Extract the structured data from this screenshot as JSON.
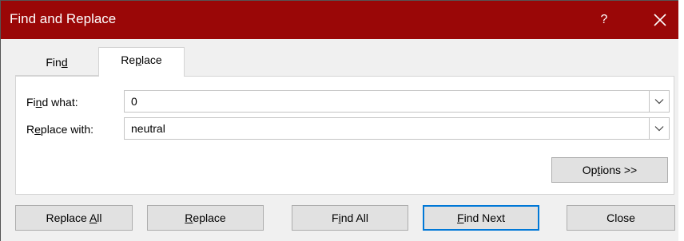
{
  "window": {
    "title": "Find and Replace",
    "help_label": "?",
    "title_bar_color": "#9a0707",
    "close_icon": "close-icon"
  },
  "tabs": [
    {
      "label": "Find",
      "access_key": "d",
      "selected": false
    },
    {
      "label": "Replace",
      "access_key": "p",
      "selected": true
    }
  ],
  "find_what": {
    "label": "Find what:",
    "access_key": "n",
    "value": "0"
  },
  "replace_with": {
    "label": "Replace with:",
    "access_key": "e",
    "value": "neutral"
  },
  "buttons": {
    "options": {
      "label": "Options >>",
      "access_key": "t"
    },
    "replace_all": {
      "label": "Replace All",
      "access_key": "A"
    },
    "replace": {
      "label": "Replace",
      "access_key": "R"
    },
    "find_all": {
      "label": "Find All",
      "access_key": "i"
    },
    "find_next": {
      "label": "Find Next",
      "access_key": "F",
      "default": true
    },
    "close": {
      "label": "Close"
    }
  }
}
